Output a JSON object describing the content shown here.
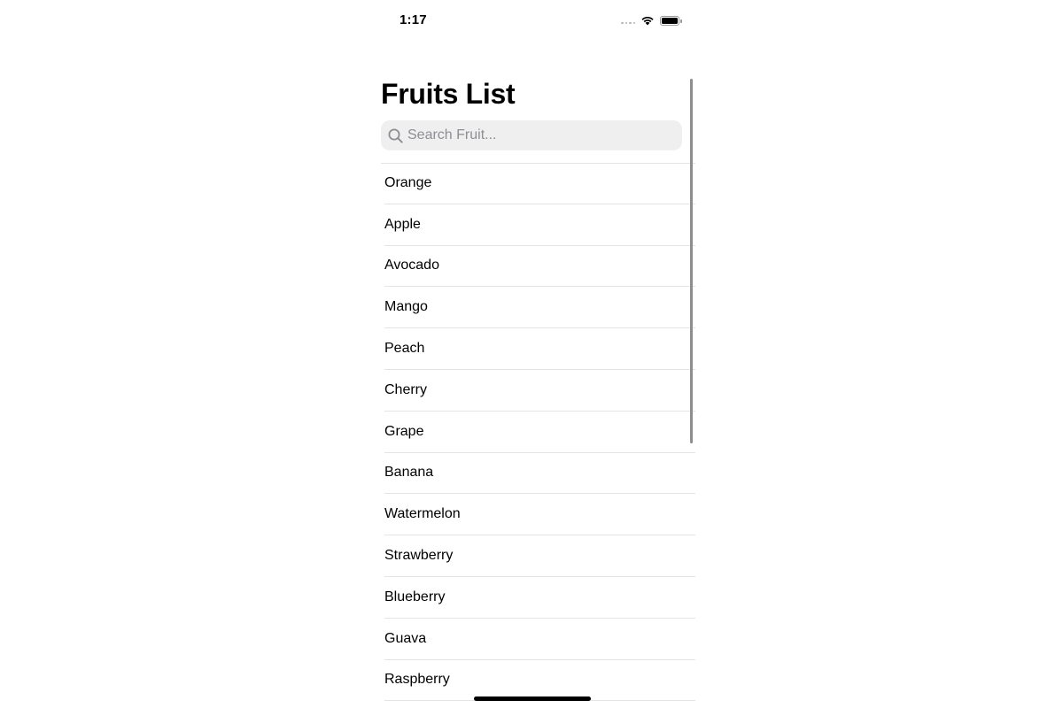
{
  "status_bar": {
    "time": "1:17",
    "icons": [
      "cellular-signal-icon",
      "wifi-icon",
      "battery-icon"
    ]
  },
  "title": "Fruits List",
  "search": {
    "placeholder": "Search Fruit...",
    "value": "",
    "icon": "search-icon"
  },
  "fruits": [
    "Orange",
    "Apple",
    "Avocado",
    "Mango",
    "Peach",
    "Cherry",
    "Grape",
    "Banana",
    "Watermelon",
    "Strawberry",
    "Blueberry",
    "Guava",
    "Raspberry"
  ],
  "colors": {
    "background": "#ffffff",
    "search_field": "#efeff0",
    "separator": "#e4e4e6",
    "placeholder": "#8e8e93"
  }
}
